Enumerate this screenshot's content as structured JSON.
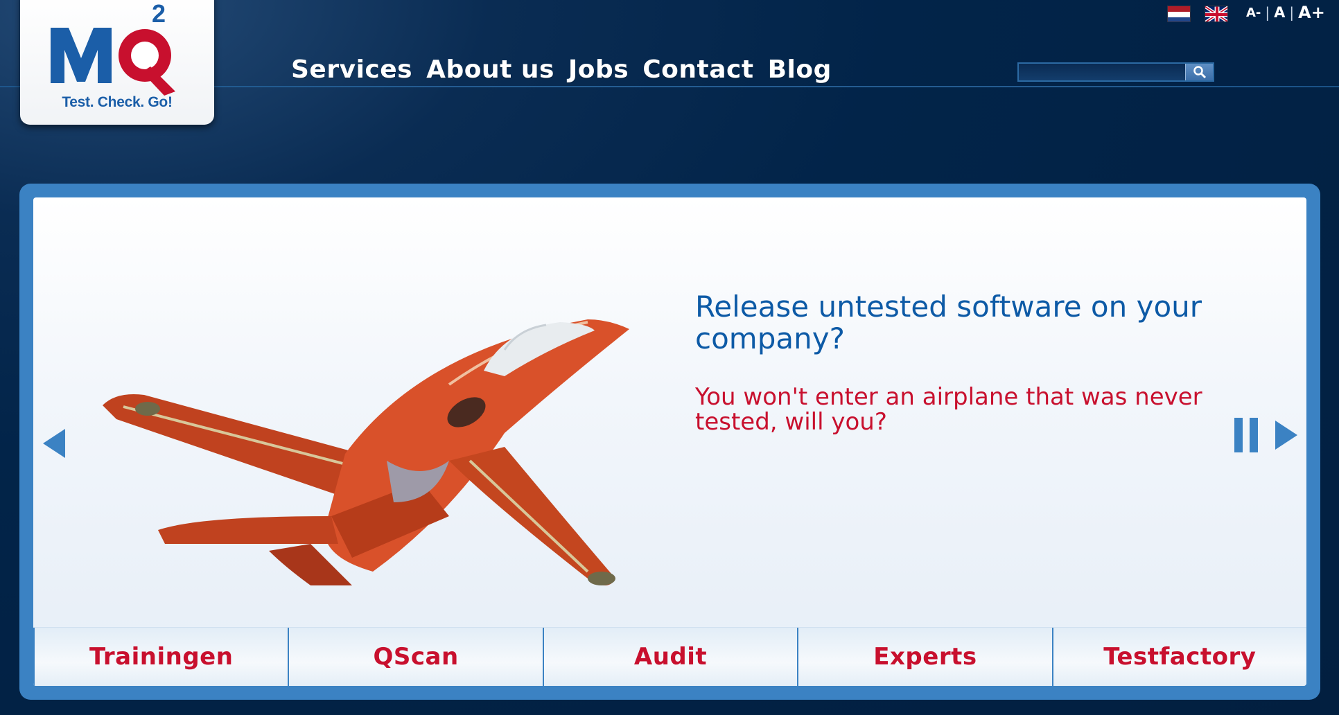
{
  "logo": {
    "letters": "MQ",
    "superscript": "2",
    "tagline": "Test. Check. Go!"
  },
  "nav": {
    "items": [
      {
        "label": "Services"
      },
      {
        "label": "About us"
      },
      {
        "label": "Jobs"
      },
      {
        "label": "Contact"
      },
      {
        "label": "Blog"
      }
    ]
  },
  "search": {
    "value": "",
    "icon": "magnifier-icon"
  },
  "languages": {
    "flags": [
      "netherlands-flag-icon",
      "uk-flag-icon"
    ]
  },
  "font_size": {
    "decrease": "A-",
    "normal": "A",
    "increase": "A+",
    "separator": "|"
  },
  "slide": {
    "headline": "Release untested software on your company?",
    "subline": "You won't enter an airplane that was never tested, will you?",
    "image": "red-jet-airplane",
    "prev_icon": "triangle-left-icon",
    "pause_icon": "pause-icon",
    "next_icon": "triangle-right-icon"
  },
  "tabs": [
    {
      "label": "Trainingen"
    },
    {
      "label": "QScan"
    },
    {
      "label": "Audit"
    },
    {
      "label": "Experts"
    },
    {
      "label": "Testfactory"
    }
  ],
  "colors": {
    "background": "#022449",
    "accent_blue": "#3b82c3",
    "headline_blue": "#0d5aa6",
    "accent_red": "#c8102e"
  }
}
